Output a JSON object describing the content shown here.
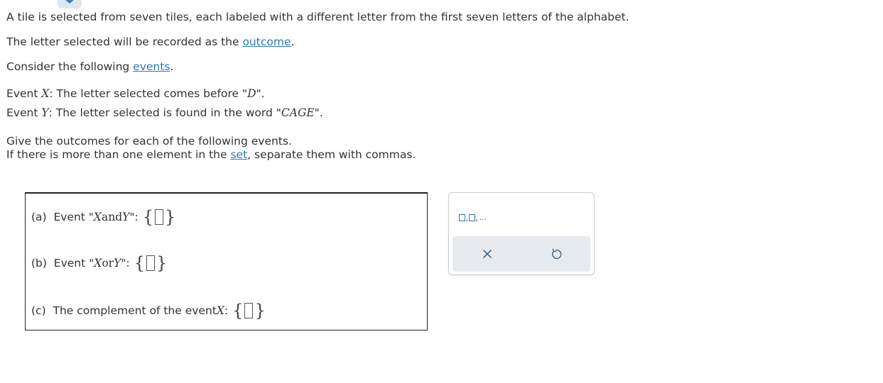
{
  "intro": {
    "line1": "A tile is selected from seven tiles, each labeled with a different letter from the first seven letters of the alphabet.",
    "line2_pre": "The letter selected will be recorded as the ",
    "line2_link": "outcome",
    "line2_post": ".",
    "line3_pre": "Consider the following ",
    "line3_link": "events",
    "line3_post": "."
  },
  "events": {
    "x_pre": "Event ",
    "x_var": "X",
    "x_mid": ": The letter selected comes before \"",
    "x_letter": "D",
    "x_post": "\".",
    "y_pre": "Event ",
    "y_var": "Y",
    "y_mid": ": The letter selected is found in the word \"",
    "y_word": "CAGE",
    "y_post": "\"."
  },
  "instructions": {
    "line1": "Give the outcomes for each of the following events.",
    "line2_pre": "If there is more than one element in the ",
    "line2_link": "set",
    "line2_post": ", separate them with commas."
  },
  "questions": {
    "a_label": "(a)",
    "a_pre": "Event \"",
    "a_var1": "X",
    "a_conj": " and ",
    "a_var2": "Y",
    "a_post": "\":",
    "b_label": "(b)",
    "b_pre": "Event \"",
    "b_var1": "X",
    "b_conj": " or ",
    "b_var2": "Y",
    "b_post": "\":",
    "c_label": "(c)",
    "c_pre": "The complement of the event ",
    "c_var": "X",
    "c_post": ":",
    "brace_open": "{",
    "brace_close": "}"
  },
  "toolbar": {
    "template_comma": ",",
    "template_dots": "..."
  },
  "colors": {
    "link": "#2b7bb9",
    "toolbar_icon": "#3a6ea5",
    "action_bar_bg": "#e7eaee"
  }
}
